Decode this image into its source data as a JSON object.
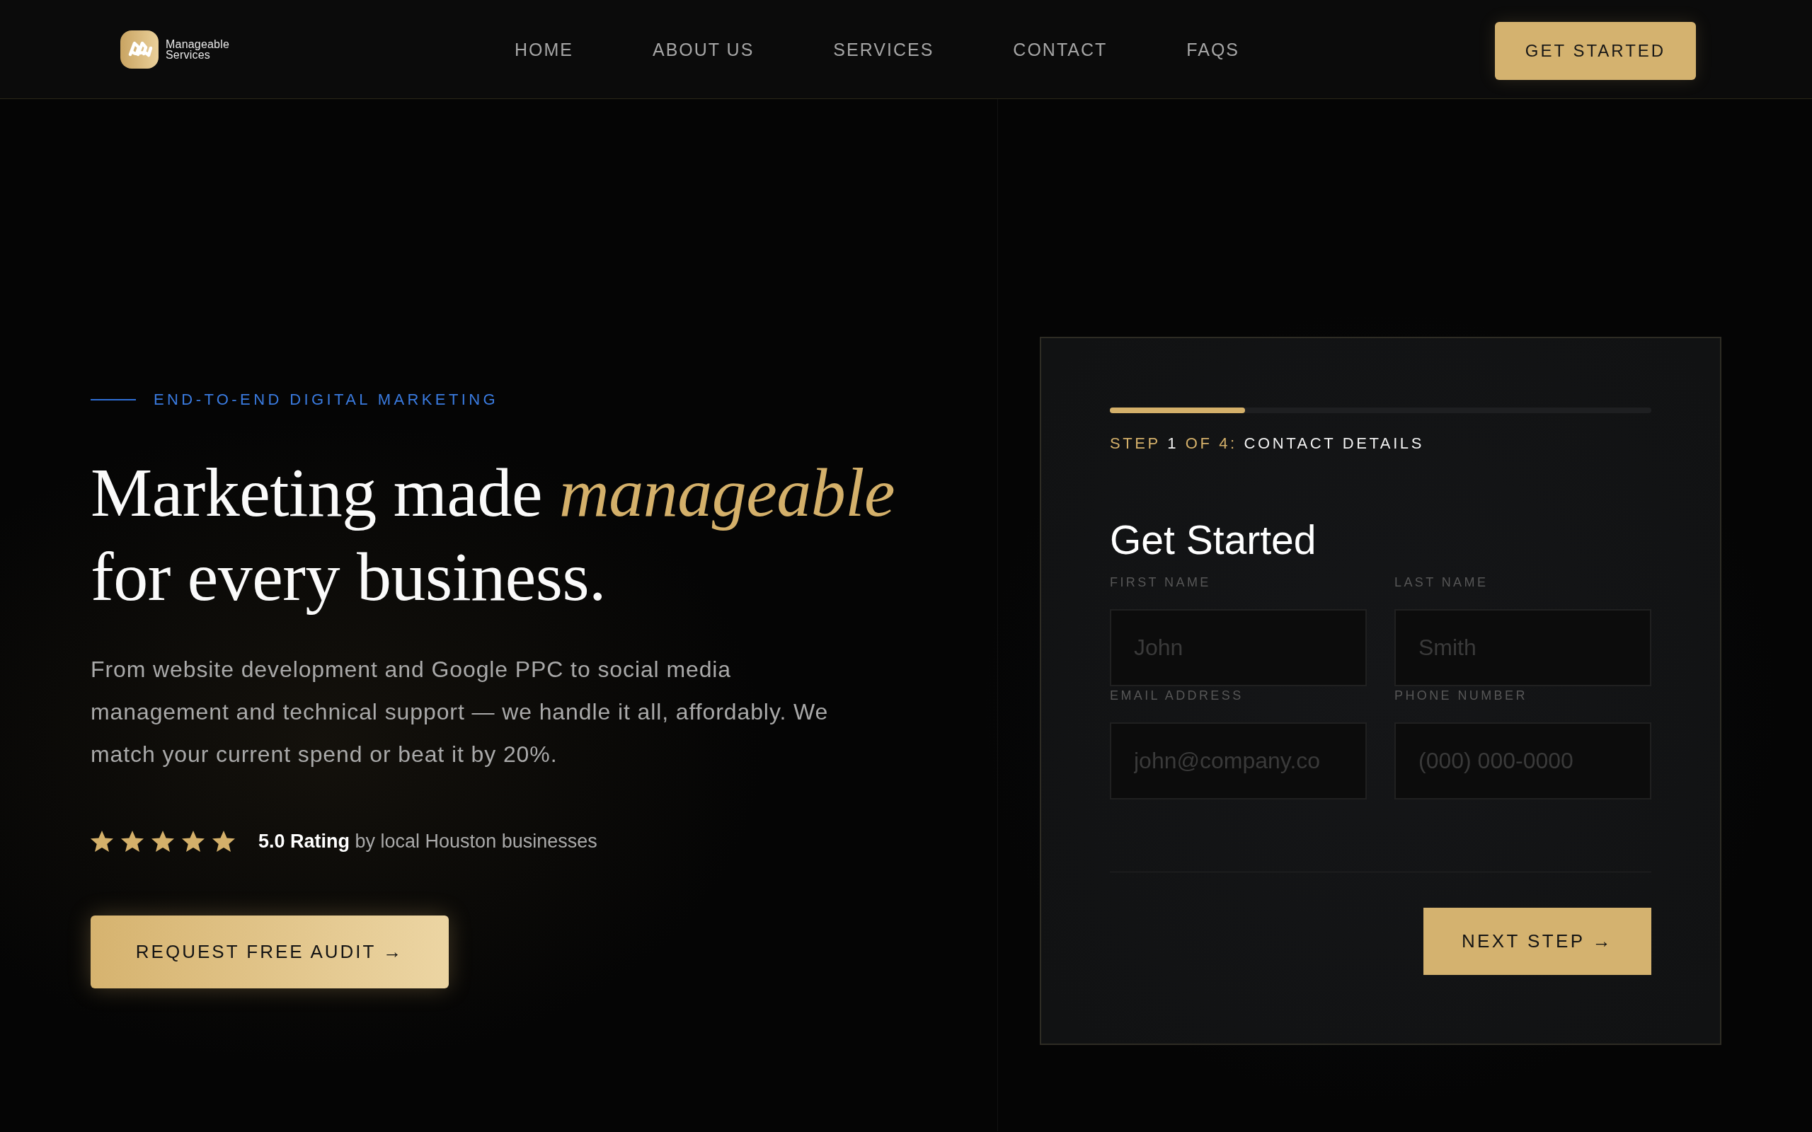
{
  "header": {
    "brand": {
      "name": "Manageable Services"
    },
    "nav": [
      {
        "label": "HOME"
      },
      {
        "label": "ABOUT US"
      },
      {
        "label": "SERVICES"
      },
      {
        "label": "CONTACT"
      },
      {
        "label": "FAQS"
      }
    ],
    "cta": "GET STARTED"
  },
  "hero": {
    "eyebrow": "END-TO-END DIGITAL MARKETING",
    "headline": "Marketing made *manageable* for every business.",
    "description": "From website development and Google PPC to social media management and technical support — we handle it all, affordably. We match your current spend or beat it by 20%.",
    "rating": {
      "stars": 5,
      "text": "**5.0 Rating** by local Houston businesses"
    },
    "button": "REQUEST FREE AUDIT →"
  },
  "form": {
    "progress": {
      "level": 0.25
    },
    "step": {
      "word": "STEP",
      "current": "1",
      "of_total": "OF 4:",
      "title": "CONTACT DETAILS"
    },
    "title": "Get Started",
    "fields": [
      {
        "label": "FIRST NAME",
        "placeholder": "John"
      },
      {
        "label": "LAST NAME",
        "placeholder": "Smith"
      },
      {
        "label": "EMAIL ADDRESS",
        "placeholder": "john@company.co"
      },
      {
        "label": "PHONE NUMBER",
        "placeholder": "(000) 000-0000"
      }
    ],
    "next_button": "NEXT STEP →"
  }
}
